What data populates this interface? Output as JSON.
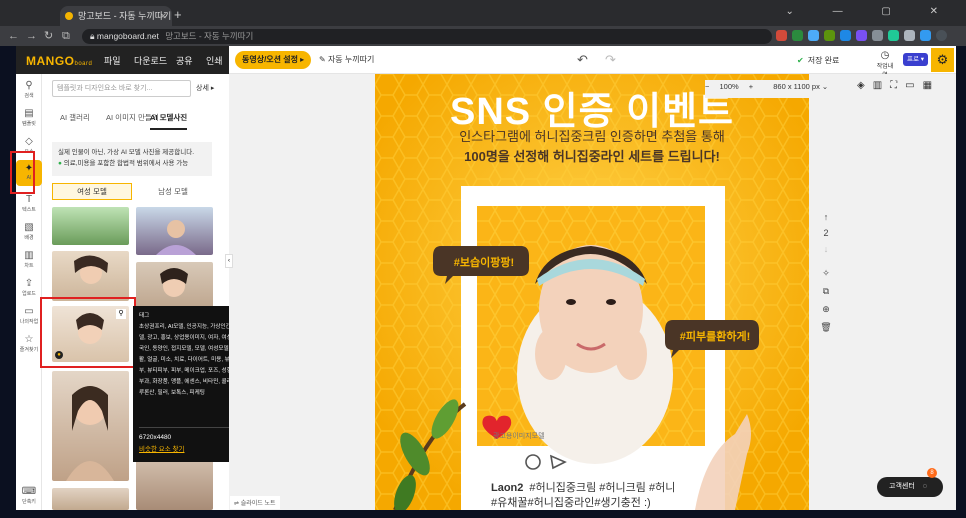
{
  "browser": {
    "tab_title": "망고보드 - 자동 누끼따기",
    "new_tab": "+",
    "url": "mangoboard.net",
    "page_title_suffix": "망고보드 - 자동 누끼따기"
  },
  "app": {
    "logo": "MANGO",
    "logo_sub": "board",
    "menu": [
      "파일",
      "다운로드",
      "공유",
      "인쇄"
    ],
    "dimension_button": "동영상/오션 설정 ▸",
    "auto_nukki": "자동 누끼따기",
    "saved_status": "저장 완료",
    "history_label": "작업내역",
    "pro_badge": "프로 ▾"
  },
  "sidebar": {
    "items": [
      {
        "label": "검색",
        "icon": "search-icon"
      },
      {
        "label": "템플릿",
        "icon": "template-icon"
      },
      {
        "label": "요소",
        "icon": "elements-icon"
      },
      {
        "label": "AI",
        "icon": "ai-icon"
      },
      {
        "label": "텍스트",
        "icon": "text-icon"
      },
      {
        "label": "배경",
        "icon": "background-icon"
      },
      {
        "label": "차트",
        "icon": "chart-icon"
      },
      {
        "label": "업로드",
        "icon": "upload-icon"
      },
      {
        "label": "나의작업",
        "icon": "folder-icon"
      },
      {
        "label": "즐겨찾기",
        "icon": "star-icon"
      },
      {
        "label": "단축키",
        "icon": "keyboard-icon"
      }
    ]
  },
  "panel": {
    "search_placeholder": "템플릿과 디자인요소 바로 찾기...",
    "detail": "상세 ▸",
    "tabs": [
      "AI 갤러리",
      "AI 이미지 만들기",
      "AI 모델사진"
    ],
    "active_tab": "AI 모델사진",
    "notice_line1": "실제 인물이 아닌, 가상 AI 모델 사진을 제공합니다.",
    "notice_line2": "의료,미용을 포함한 합법적 범위에서 사용 가능",
    "female_model": "여성 모델",
    "male_model": "남성 모델"
  },
  "tooltip": {
    "tag_label": "태그",
    "tags": "초상권프리, AI모델, 인공지능, 가상인간, 가상모델, 광고, 홍보, 상업용이미지, 여자, 여성, 사진, 한국인, 동양인, 접지모델, 모델, 여성모델, 미모, 생활, 얼굴, 미소, 치료, 다이어트, 미용, 뷰티모델, 피부, 뷰티피부, 피부, 메이크업, 포즈, 성형외과, 피부과, 화장품, 맹플, 에센스, 비타민, 콜라겐, 히알루론산, 필러, 보톡스, 피케팅",
    "resolution": "6720x4480",
    "similar": "비슷한 요소 찾기"
  },
  "canvas": {
    "zoom": "100%",
    "size": "860 x 1100 px",
    "page_number": "2"
  },
  "poster": {
    "title": "SNS 인증 이벤트",
    "subtitle": "인스타그램에 허니집중크림 인증하면 추첨을 통해",
    "subtitle_bold": "100명을 선정해 허니집중라인 세트를 드립니다!",
    "bubble_left": "#보습이팡팡!",
    "bubble_right": "#피부를환하게!",
    "watermark": "광고용이미지모델",
    "username": "Laon2",
    "hashtags1": "#허니집중크림 #허니크림 #허니",
    "hashtags2": "#유채꿀#허니집중라인#생기충전 :)"
  },
  "support": {
    "label": "고객센터",
    "badge": "8"
  },
  "slide_note": "슬라이드 노트"
}
